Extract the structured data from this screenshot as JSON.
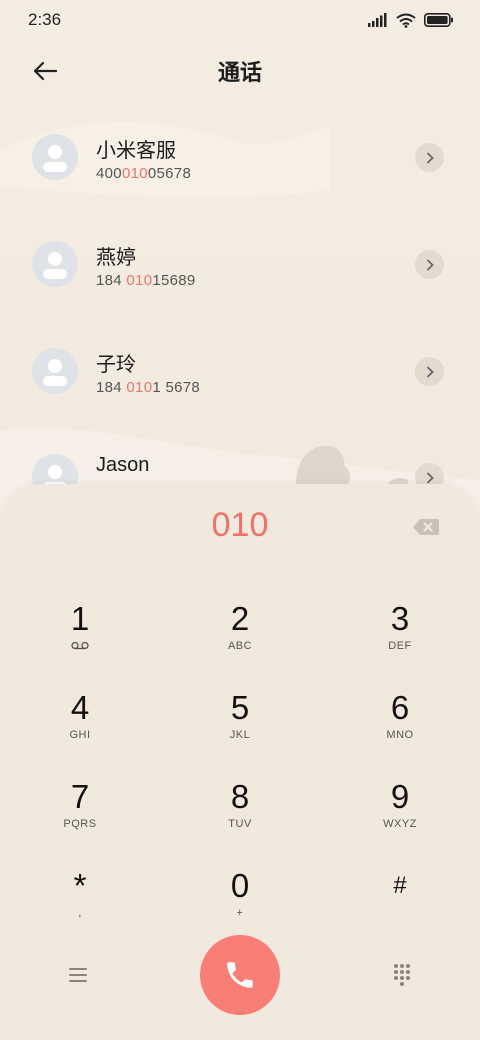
{
  "status_bar": {
    "time": "2:36"
  },
  "header": {
    "title": "通话"
  },
  "contacts": [
    {
      "name": "小米客服",
      "number_pre": "400",
      "number_match": "010",
      "number_post": "05678"
    },
    {
      "name": "燕婷",
      "number_pre": "184 ",
      "number_match": "010",
      "number_post": "15689"
    },
    {
      "name": "子玲",
      "number_pre": "184 ",
      "number_match": "010",
      "number_post": "1 5678"
    },
    {
      "name": "Jason",
      "number_pre": "",
      "number_match": "",
      "number_post": ""
    }
  ],
  "dialer": {
    "input": "010",
    "keys": [
      {
        "digit": "1",
        "letters": ""
      },
      {
        "digit": "2",
        "letters": "ABC"
      },
      {
        "digit": "3",
        "letters": "DEF"
      },
      {
        "digit": "4",
        "letters": "GHI"
      },
      {
        "digit": "5",
        "letters": "JKL"
      },
      {
        "digit": "6",
        "letters": "MNO"
      },
      {
        "digit": "7",
        "letters": "PQRS"
      },
      {
        "digit": "8",
        "letters": "TUV"
      },
      {
        "digit": "9",
        "letters": "WXYZ"
      },
      {
        "digit": "*",
        "letters": ","
      },
      {
        "digit": "0",
        "letters": "+"
      },
      {
        "digit": "#",
        "letters": ""
      }
    ]
  },
  "icons": {
    "back": "back-arrow-icon",
    "voicemail": "voicemail-icon",
    "backspace": "backspace-icon",
    "menu": "menu-icon",
    "call": "phone-icon",
    "dialpad": "dialpad-icon"
  },
  "colors": {
    "accent": "#f0706a",
    "call_button": "#f87e76",
    "background": "#f3ebe0",
    "avatar": "#dfe2e6"
  }
}
